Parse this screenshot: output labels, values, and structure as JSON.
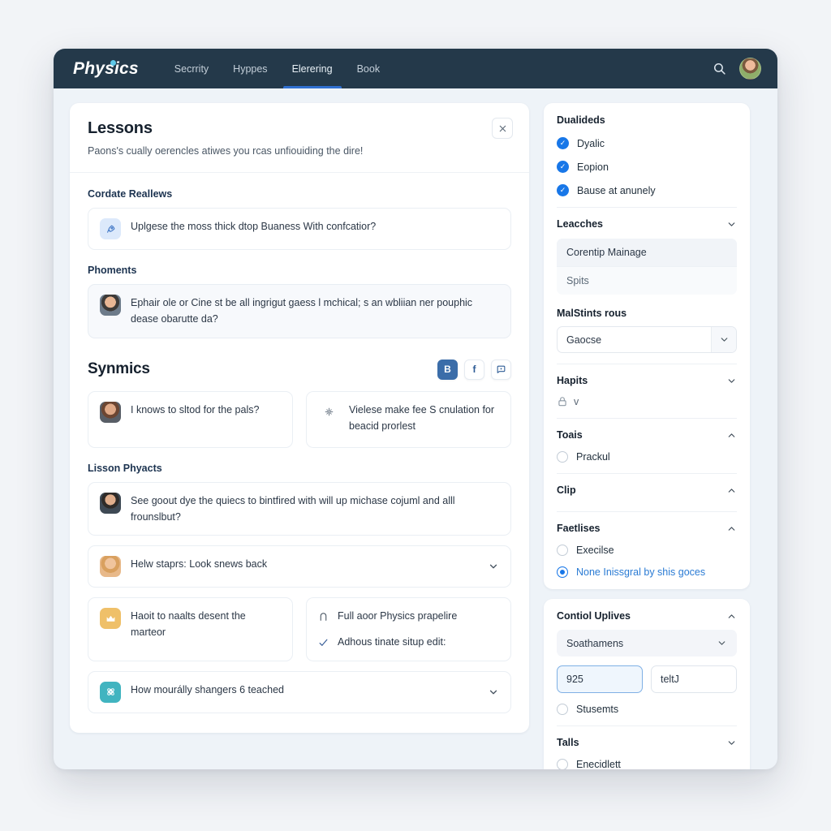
{
  "header": {
    "brand": "Physics",
    "nav": [
      {
        "label": "Secrrity",
        "active": false
      },
      {
        "label": "Hyppes",
        "active": false
      },
      {
        "label": "Elerering",
        "active": true
      },
      {
        "label": "Book",
        "active": false
      }
    ],
    "search_icon": "search-icon",
    "avatar": "user-avatar"
  },
  "lessons": {
    "title": "Lessons",
    "subtitle": "Paons's cually oerencles atiwes you rcas unfiouiding the dire!",
    "close_label": "×",
    "section1_label": "Cordate Reallews",
    "row1_text": "Uplgese the moss thick dtop Buaness With confcatior?",
    "section2_label": "Phoments",
    "row2_text": "Ephair ole or Cine st be all ingrigut gaess l mchical; s an wbliian ner pouphic dease obarutte da?"
  },
  "synmics": {
    "title": "Synmics",
    "actions": [
      {
        "name": "bold-button",
        "label": "B",
        "filled": true
      },
      {
        "name": "facebook-button",
        "label": "f",
        "filled": false
      },
      {
        "name": "comment-button",
        "label": "",
        "filled": false
      }
    ],
    "card_left": "I knows to sltod for the pals?",
    "card_right": "Vielese make fee S cnulation for beacid prorlest"
  },
  "lesson_phyacts": {
    "label": "Lisson Phyacts",
    "row1": "See goout dye the quiecs to bintfired with will up michase cojuml and alll frounslbut?",
    "row2": "Helw staprs: Look snews back",
    "card_left": "Haoit to naalts desent the marteor",
    "card_right_line1": "Full aoor Physics prapelire",
    "card_right_line2": "Adhous tinate situp edit:",
    "row3": "How mourálly shangers 6 teached"
  },
  "sidebar": {
    "dualideds": {
      "title": "Dualideds",
      "items": [
        {
          "label": "Dyalic"
        },
        {
          "label": "Eopion"
        },
        {
          "label": "Bause at anunely"
        }
      ]
    },
    "leaches": {
      "title": "Leacches",
      "items": [
        {
          "label": "Corentip Mainage",
          "selected": true
        },
        {
          "label": "Spits",
          "selected": false
        }
      ]
    },
    "malstints": {
      "label": "MalStints rous",
      "value": "Gaocse"
    },
    "hapits": {
      "title": "Hapits",
      "lock_text": "v"
    },
    "tools": {
      "title": "Toais",
      "option": "Prackul"
    },
    "clip": {
      "title": "Clip"
    },
    "faetlises": {
      "title": "Faetlises",
      "option1": "Execilse",
      "option2": "None Inissgral by shis goces"
    },
    "contiol": {
      "title": "Contiol Uplives",
      "select_value": "Soathamens",
      "input1_value": "925",
      "input2_value": "teltJ",
      "option": "Stusemts"
    },
    "talls": {
      "title": "Talls",
      "option": "Enecidlett"
    }
  },
  "colors": {
    "nav_bg": "#24394a",
    "accent_blue": "#2f6fd0",
    "check_blue": "#1877e8",
    "amber": "#efc069",
    "teal": "#41b4c0",
    "page_bg": "#f2f4f7"
  }
}
